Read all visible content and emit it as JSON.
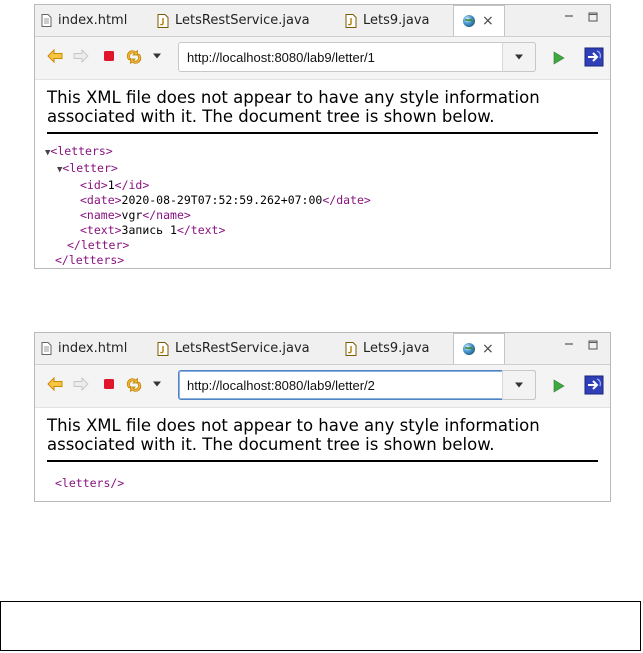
{
  "tabs": [
    {
      "label": "index.html",
      "icon": "file-icon"
    },
    {
      "label": "LetsRestService.java",
      "icon": "java-file-icon"
    },
    {
      "label": "Lets9.java",
      "icon": "java-file-icon"
    },
    {
      "label": "",
      "icon": "globe-icon",
      "close": "×"
    }
  ],
  "windows": [
    {
      "url": "http://localhost:8080/lab9/letter/1",
      "message": "This XML file does not appear to have any style information associated with it. The document tree is shown below.",
      "tree": {
        "root_open": "<letters>",
        "letter_open": "<letter>",
        "id_open": "<id>",
        "id_value": "1",
        "id_close": "</id>",
        "date_open": "<date>",
        "date_value": "2020-08-29T07:52:59.262+07:00",
        "date_close": "</date>",
        "name_open": "<name>",
        "name_value": "vgr",
        "name_close": "</name>",
        "text_open": "<text>",
        "text_value": "Запись 1",
        "text_close": "</text>",
        "letter_close": "</letter>",
        "root_close": "</letters>"
      }
    },
    {
      "url": "http://localhost:8080/lab9/letter/2",
      "message": "This XML file does not appear to have any style information associated with it. The document tree is shown below.",
      "tree": {
        "empty": "<letters/>"
      }
    }
  ],
  "colors": {
    "tag": "#881280",
    "go": "#3fa83f",
    "stop": "#e0162b",
    "back": "#e9a400",
    "url_focus": "#4f83c4"
  }
}
